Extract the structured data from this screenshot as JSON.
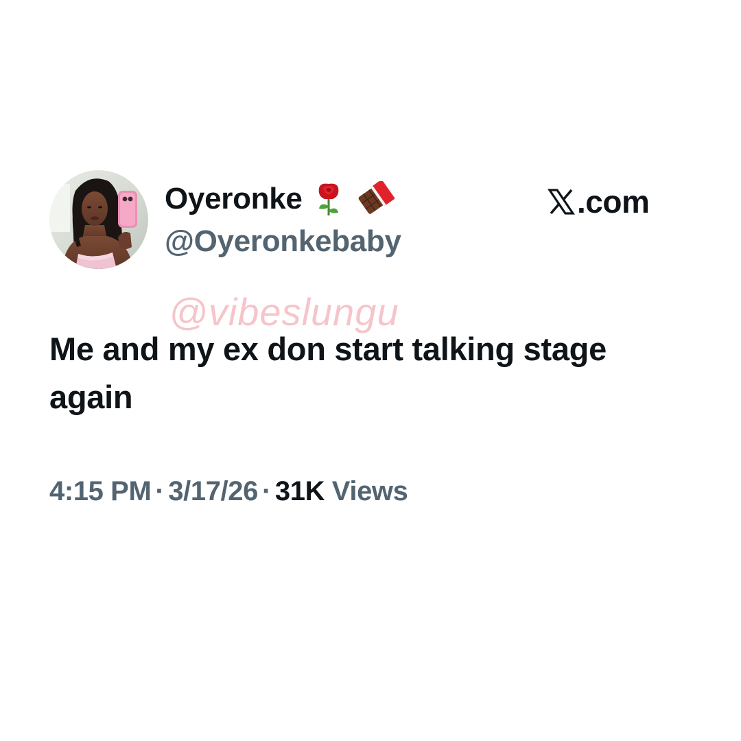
{
  "tweet": {
    "author": {
      "display_name": "Oyeronke",
      "name_emojis": [
        "rose-emoji",
        "chocolate-bar-emoji"
      ],
      "handle": "@Oyeronkebaby",
      "avatar": "profile-photo"
    },
    "brand": {
      "logo_icon": "x-logo-icon",
      "text": ".com"
    },
    "watermark": "@vibeslungu",
    "text": "Me and my ex don start talking stage again",
    "meta": {
      "time": "4:15 PM",
      "separator": "·",
      "date": "3/17/26",
      "views_count": "31K",
      "views_label": "Views"
    }
  },
  "colors": {
    "text_primary": "#0f1419",
    "text_secondary": "#536471",
    "watermark": "#ec969e",
    "background": "#ffffff"
  }
}
